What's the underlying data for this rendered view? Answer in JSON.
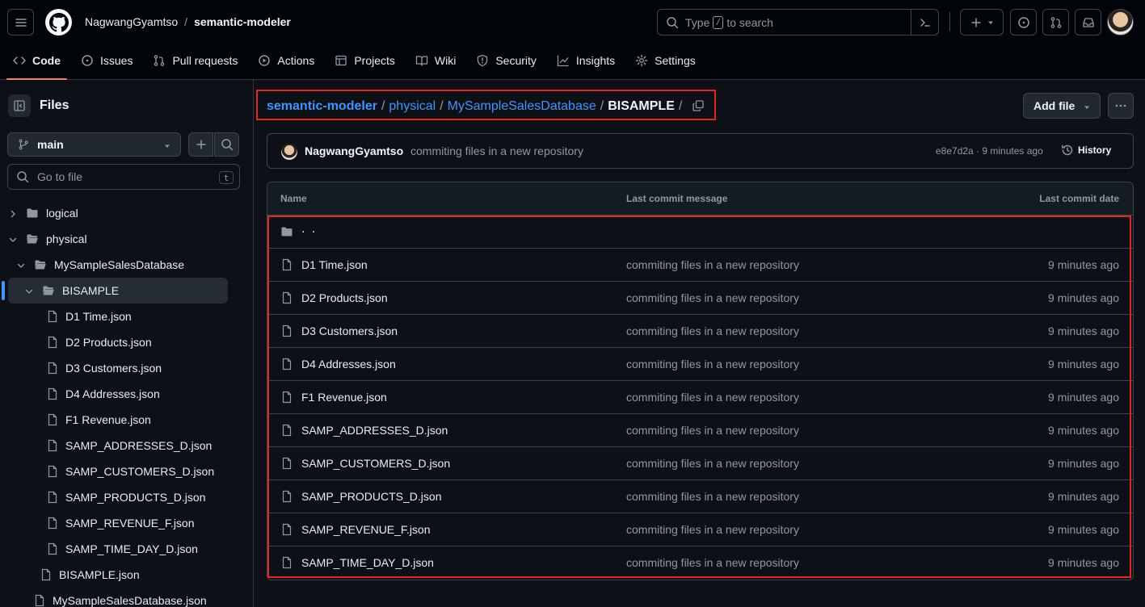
{
  "header": {
    "owner": "NagwangGyamtso",
    "separator": "/",
    "repo": "semantic-modeler",
    "search_prefix": "Type",
    "search_key": "/",
    "search_suffix": "to search"
  },
  "tabs": [
    {
      "label": "Code",
      "icon": "code-icon",
      "active": true
    },
    {
      "label": "Issues",
      "icon": "issue-icon"
    },
    {
      "label": "Pull requests",
      "icon": "pull-request-icon"
    },
    {
      "label": "Actions",
      "icon": "play-icon"
    },
    {
      "label": "Projects",
      "icon": "table-icon"
    },
    {
      "label": "Wiki",
      "icon": "book-icon"
    },
    {
      "label": "Security",
      "icon": "shield-icon"
    },
    {
      "label": "Insights",
      "icon": "graph-icon"
    },
    {
      "label": "Settings",
      "icon": "gear-icon"
    }
  ],
  "sidebar": {
    "title": "Files",
    "branch": "main",
    "go_to_file_placeholder": "Go to file",
    "go_to_file_key": "t",
    "tree": [
      {
        "label": "logical",
        "type": "folder",
        "depth": 0,
        "expanded": false
      },
      {
        "label": "physical",
        "type": "folder",
        "depth": 0,
        "expanded": true
      },
      {
        "label": "MySampleSalesDatabase",
        "type": "folder",
        "depth": 1,
        "expanded": true
      },
      {
        "label": "BISAMPLE",
        "type": "folder",
        "depth": 2,
        "expanded": true,
        "selected": true
      },
      {
        "label": "D1 Time.json",
        "type": "file",
        "depth": 3
      },
      {
        "label": "D2 Products.json",
        "type": "file",
        "depth": 3
      },
      {
        "label": "D3 Customers.json",
        "type": "file",
        "depth": 3
      },
      {
        "label": "D4 Addresses.json",
        "type": "file",
        "depth": 3
      },
      {
        "label": "F1 Revenue.json",
        "type": "file",
        "depth": 3
      },
      {
        "label": "SAMP_ADDRESSES_D.json",
        "type": "file",
        "depth": 3
      },
      {
        "label": "SAMP_CUSTOMERS_D.json",
        "type": "file",
        "depth": 3
      },
      {
        "label": "SAMP_PRODUCTS_D.json",
        "type": "file",
        "depth": 3
      },
      {
        "label": "SAMP_REVENUE_F.json",
        "type": "file",
        "depth": 3
      },
      {
        "label": "SAMP_TIME_DAY_D.json",
        "type": "file",
        "depth": 3
      },
      {
        "label": "BISAMPLE.json",
        "type": "file",
        "depth": 2
      },
      {
        "label": "MySampleSalesDatabase.json",
        "type": "file",
        "depth": 1
      }
    ]
  },
  "breadcrumb": {
    "parts": [
      "semantic-modeler",
      "physical",
      "MySampleSalesDatabase"
    ],
    "current": "BISAMPLE",
    "separator": "/"
  },
  "actions": {
    "add_file": "Add file"
  },
  "latest_commit": {
    "author": "NagwangGyamtso",
    "message": "commiting files in a new repository",
    "sha_and_time": "e8e7d2a · 9 minutes ago",
    "history_label": "History"
  },
  "table": {
    "headers": {
      "name": "Name",
      "message": "Last commit message",
      "date": "Last commit date"
    },
    "parent_label": ". .",
    "rows": [
      {
        "name": "D1 Time.json",
        "message": "commiting files in a new repository",
        "date": "9 minutes ago"
      },
      {
        "name": "D2 Products.json",
        "message": "commiting files in a new repository",
        "date": "9 minutes ago"
      },
      {
        "name": "D3 Customers.json",
        "message": "commiting files in a new repository",
        "date": "9 minutes ago"
      },
      {
        "name": "D4 Addresses.json",
        "message": "commiting files in a new repository",
        "date": "9 minutes ago"
      },
      {
        "name": "F1 Revenue.json",
        "message": "commiting files in a new repository",
        "date": "9 minutes ago"
      },
      {
        "name": "SAMP_ADDRESSES_D.json",
        "message": "commiting files in a new repository",
        "date": "9 minutes ago"
      },
      {
        "name": "SAMP_CUSTOMERS_D.json",
        "message": "commiting files in a new repository",
        "date": "9 minutes ago"
      },
      {
        "name": "SAMP_PRODUCTS_D.json",
        "message": "commiting files in a new repository",
        "date": "9 minutes ago"
      },
      {
        "name": "SAMP_REVENUE_F.json",
        "message": "commiting files in a new repository",
        "date": "9 minutes ago"
      },
      {
        "name": "SAMP_TIME_DAY_D.json",
        "message": "commiting files in a new repository",
        "date": "9 minutes ago"
      }
    ]
  },
  "colors": {
    "accent_link": "#4493f8",
    "active_tab_underline": "#f78166",
    "highlight_box": "#e5281f"
  }
}
